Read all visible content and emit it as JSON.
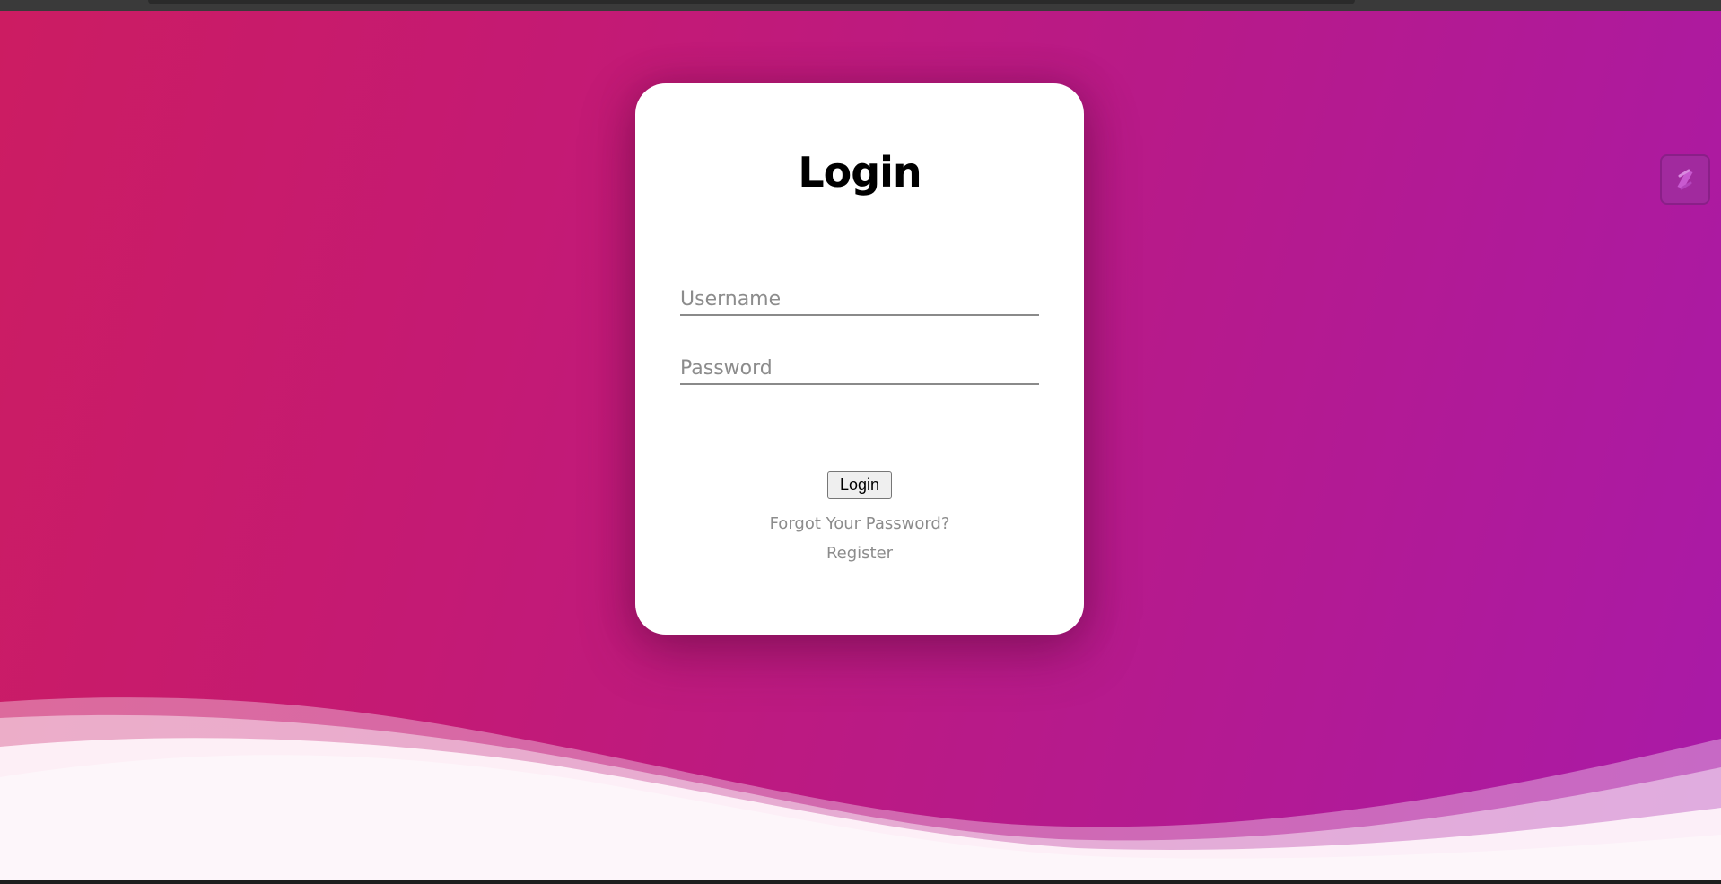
{
  "login": {
    "title": "Login",
    "username_placeholder": "Username",
    "password_placeholder": "Password",
    "submit_label": "Login",
    "forgot_password_link": "Forgot Your Password?",
    "register_link": "Register"
  },
  "extension": {
    "icon": "slash-logo-icon"
  },
  "colors": {
    "background_start": "#cc1c62",
    "background_end": "#a91aa8",
    "card": "#ffffff",
    "placeholder": "#8c8c8c",
    "link": "#8c8c8c"
  }
}
